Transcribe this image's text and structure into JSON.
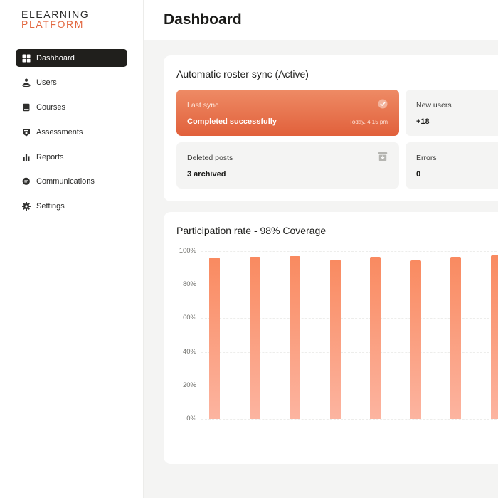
{
  "app": {
    "logo_line1": "ELEARNING",
    "logo_line2": "PLATFORM",
    "brand_color": "#e2673f"
  },
  "sidebar": {
    "items": [
      {
        "label": "Dashboard",
        "icon": "grid-icon",
        "active": true
      },
      {
        "label": "Users",
        "icon": "users-icon",
        "active": false
      },
      {
        "label": "Courses",
        "icon": "book-icon",
        "active": false
      },
      {
        "label": "Assessments",
        "icon": "assessment-icon",
        "active": false
      },
      {
        "label": "Reports",
        "icon": "bar-chart-icon",
        "active": false
      },
      {
        "label": "Communications",
        "icon": "chat-icon",
        "active": false
      },
      {
        "label": "Settings",
        "icon": "gear-icon",
        "active": false
      }
    ]
  },
  "header": {
    "title": "Dashboard"
  },
  "sync": {
    "title": "Automatic roster sync (Active)",
    "last_sync": {
      "label": "Last sync",
      "value": "Completed successfully",
      "time": "Today, 4:15 pm",
      "icon": "check-circle-icon"
    },
    "new_users": {
      "label": "New users",
      "value": "+18"
    },
    "deleted_posts": {
      "label": "Deleted posts",
      "value": "3 archived",
      "icon": "archive-icon"
    },
    "errors": {
      "label": "Errors",
      "value": "0"
    }
  },
  "participation": {
    "title": "Participation rate - 98% Coverage"
  },
  "chart_data": {
    "type": "bar",
    "title": "Participation rate - 98% Coverage",
    "y_tick_labels": [
      "100%",
      "80%",
      "60%",
      "40%",
      "20%",
      "0%"
    ],
    "ylim": [
      0,
      100
    ],
    "grid": true,
    "values": [
      96,
      96.5,
      97,
      95,
      96.5,
      94.5,
      96.5,
      97.5
    ],
    "bar_color_top": "#f98a60",
    "bar_color_bottom": "#fcb4a0"
  }
}
